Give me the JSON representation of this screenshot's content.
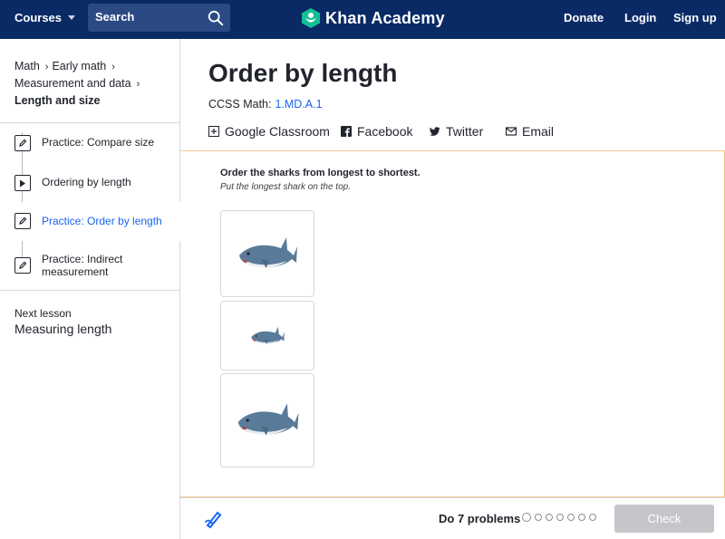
{
  "topnav": {
    "courses_label": "Courses",
    "search_placeholder": "Search",
    "logo_text": "Khan Academy",
    "donate": "Donate",
    "login": "Login",
    "signup": "Sign up",
    "bg_color": "#0a2a66"
  },
  "sidebar": {
    "breadcrumb": {
      "math": "Math",
      "early_math": "Early math",
      "measurement": "Measurement and data",
      "current": "Length and size"
    },
    "lessons": [
      {
        "label": "Practice: Compare size",
        "icon": "pencil-icon",
        "active": false
      },
      {
        "label": "Ordering by length",
        "icon": "play-icon",
        "active": false
      },
      {
        "label": "Practice: Order by length",
        "icon": "pencil-icon",
        "active": true
      },
      {
        "label": "Practice: Indirect measurement",
        "icon": "pencil-icon",
        "active": false
      }
    ],
    "next_label": "Next lesson",
    "next_title": "Measuring length"
  },
  "main": {
    "title": "Order by length",
    "ccss_label": "CCSS Math:",
    "ccss_code": "1.MD.A.1",
    "share": {
      "google": "Google Classroom",
      "facebook": "Facebook",
      "twitter": "Twitter",
      "email": "Email"
    }
  },
  "exercise": {
    "instruction": "Order the sharks from longest to shortest.",
    "hint": "Put the longest shark on the top.",
    "cards": [
      "shark-medium",
      "shark-small",
      "shark-large"
    ]
  },
  "footer": {
    "do_problems": "Do 7 problems",
    "problem_count": 7,
    "check_label": "Check"
  },
  "colors": {
    "accent": "#1865f2",
    "exercise_border": "#f3c892",
    "check_disabled": "#c4c6ca"
  }
}
